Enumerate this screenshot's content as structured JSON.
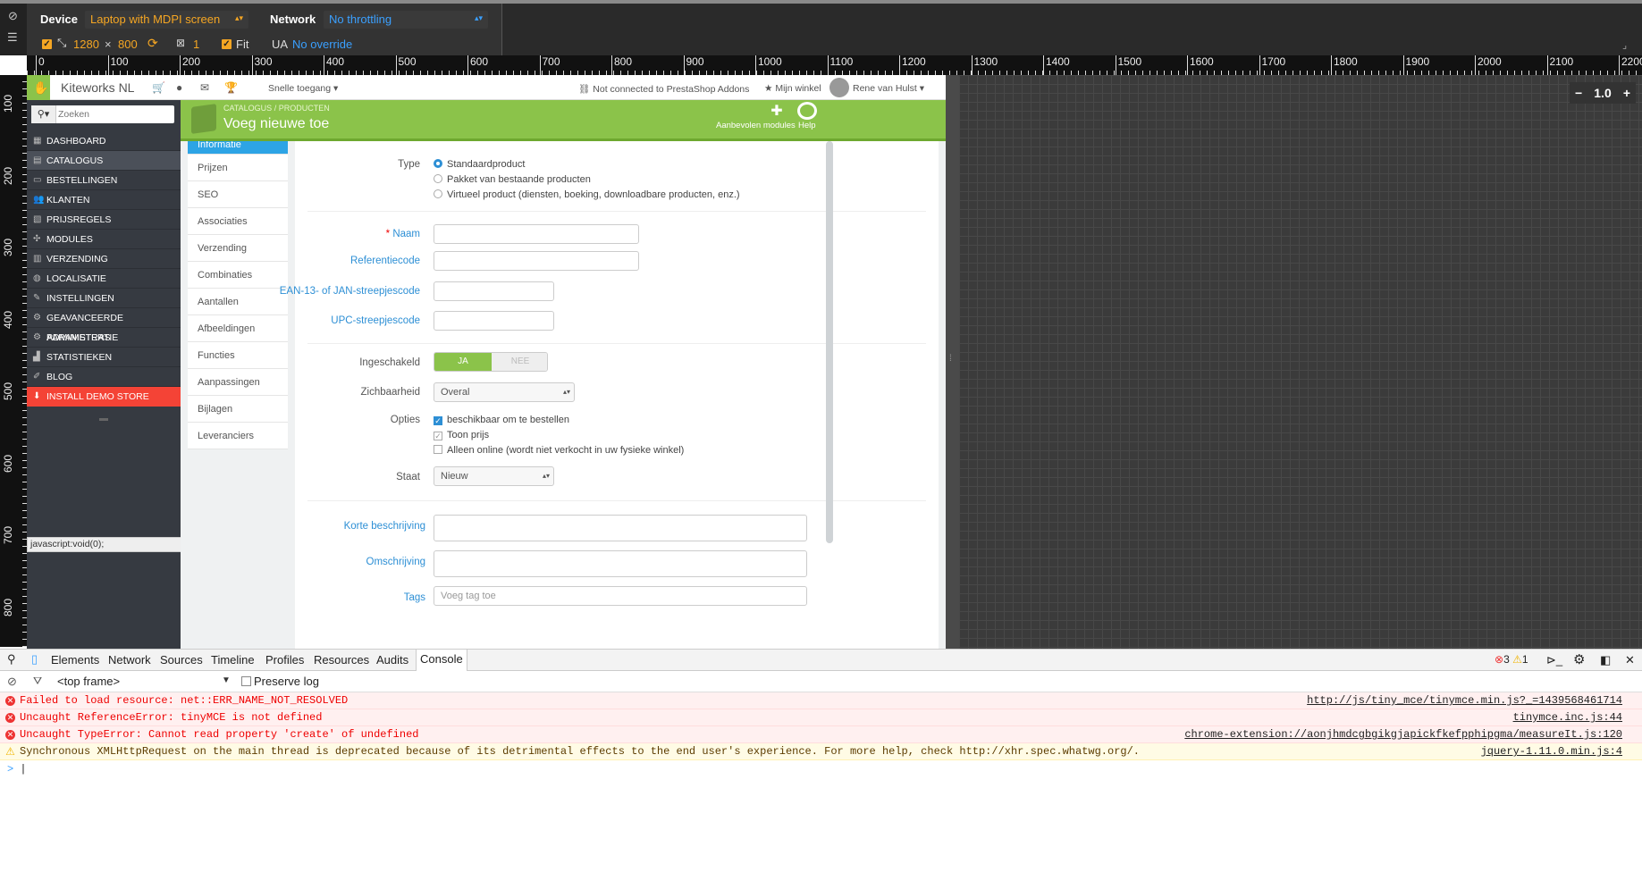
{
  "device_toolbar": {
    "device_label": "Device",
    "device_value": "Laptop with MDPI screen",
    "network_label": "Network",
    "network_value": "No throttling",
    "width": "1280",
    "times": "×",
    "height": "800",
    "dpr": "1",
    "fit_label": "Fit",
    "ua_label": "UA",
    "ua_value": "No override"
  },
  "ruler": {
    "h_ticks": [
      "0",
      "100",
      "200",
      "300",
      "400",
      "500",
      "600",
      "700",
      "800",
      "900",
      "1000",
      "1100",
      "1200",
      "1300",
      "1400",
      "1500",
      "1600",
      "1700",
      "1800",
      "1900",
      "2000",
      "2100",
      "2200"
    ],
    "v_ticks": [
      "100",
      "200",
      "300",
      "400",
      "500",
      "600",
      "700",
      "800"
    ],
    "zoom": "1.0"
  },
  "header": {
    "store_name": "Kiteworks NL",
    "quick_access": "Snelle toegang",
    "addons_status": "Not connected to PrestaShop Addons",
    "my_shop": "Mijn winkel",
    "user_name": "Rene van Hulst"
  },
  "sidebar": {
    "search_placeholder": "Zoeken",
    "items": [
      {
        "label": "Dashboard"
      },
      {
        "label": "Catalogus"
      },
      {
        "label": "Bestellingen"
      },
      {
        "label": "Klanten"
      },
      {
        "label": "Prijsregels"
      },
      {
        "label": "Modules"
      },
      {
        "label": "Verzending"
      },
      {
        "label": "Localisatie"
      },
      {
        "label": "Instellingen"
      },
      {
        "label": "Geavanceerde parameters"
      },
      {
        "label": "Administratie"
      },
      {
        "label": "Statistieken"
      },
      {
        "label": "Blog"
      },
      {
        "label": "Install demo store"
      }
    ],
    "status_url": "javascript:void(0);"
  },
  "toolbar": {
    "breadcrumb_1": "CATALOGUS",
    "breadcrumb_sep": "/",
    "breadcrumb_2": "PRODUCTEN",
    "title": "Voeg nieuwe toe",
    "recommended_modules": "Aanbevolen modules",
    "help": "Help"
  },
  "product_tabs": [
    {
      "label": "Informatie"
    },
    {
      "label": "Prijzen"
    },
    {
      "label": "SEO"
    },
    {
      "label": "Associaties"
    },
    {
      "label": "Verzending"
    },
    {
      "label": "Combinaties"
    },
    {
      "label": "Aantallen"
    },
    {
      "label": "Afbeeldingen"
    },
    {
      "label": "Functies"
    },
    {
      "label": "Aanpassingen"
    },
    {
      "label": "Bijlagen"
    },
    {
      "label": "Leveranciers"
    }
  ],
  "form": {
    "type_label": "Type",
    "type_options": [
      "Standaardproduct",
      "Pakket van bestaande producten",
      "Virtueel product (diensten, boeking, downloadbare producten, enz.)"
    ],
    "name_label": "Naam",
    "ref_label": "Referentiecode",
    "ean_label": "EAN-13- of JAN-streepjescode",
    "upc_label": "UPC-streepjescode",
    "enabled_label": "Ingeschakeld",
    "yes": "JA",
    "no": "NEE",
    "visibility_label": "Zichbaarheid",
    "visibility_value": "Overal",
    "options_label": "Opties",
    "options": [
      "beschikbaar om te bestellen",
      "Toon prijs",
      "Alleen online (wordt niet verkocht in uw fysieke winkel)"
    ],
    "condition_label": "Staat",
    "condition_value": "Nieuw",
    "short_desc_label": "Korte beschrijving",
    "desc_label": "Omschrijving",
    "tags_label": "Tags",
    "tags_placeholder": "Voeg tag toe"
  },
  "devtools": {
    "tabs": [
      "Elements",
      "Network",
      "Sources",
      "Timeline",
      "Profiles",
      "Resources",
      "Audits",
      "Console"
    ],
    "error_count": "3",
    "warn_count": "1",
    "frame": "<top frame>",
    "preserve_log": "Preserve log",
    "messages": [
      {
        "type": "error",
        "text": "Failed to load resource: net::ERR_NAME_NOT_RESOLVED",
        "source": "http://js/tiny_mce/tinymce.min.js?_=1439568461714"
      },
      {
        "type": "error",
        "text": "Uncaught ReferenceError: tinyMCE is not defined",
        "source": "tinymce.inc.js:44"
      },
      {
        "type": "error",
        "text": "Uncaught TypeError: Cannot read property 'create' of undefined",
        "source": "chrome-extension://aonjhmdcgbgikgjapickfkefpphipgma/measureIt.js:120"
      },
      {
        "type": "warn",
        "text": "Synchronous XMLHttpRequest on the main thread is deprecated because of its detrimental effects to the end user's experience. For more help, check http://xhr.spec.whatwg.org/.",
        "source": "jquery-1.11.0.min.js:4"
      }
    ],
    "prompt": ">"
  },
  "colors": {
    "accent_green": "#8bc34a",
    "sidebar": "#363a41",
    "install_red": "#f44336",
    "link_blue": "#2d8fd5"
  }
}
